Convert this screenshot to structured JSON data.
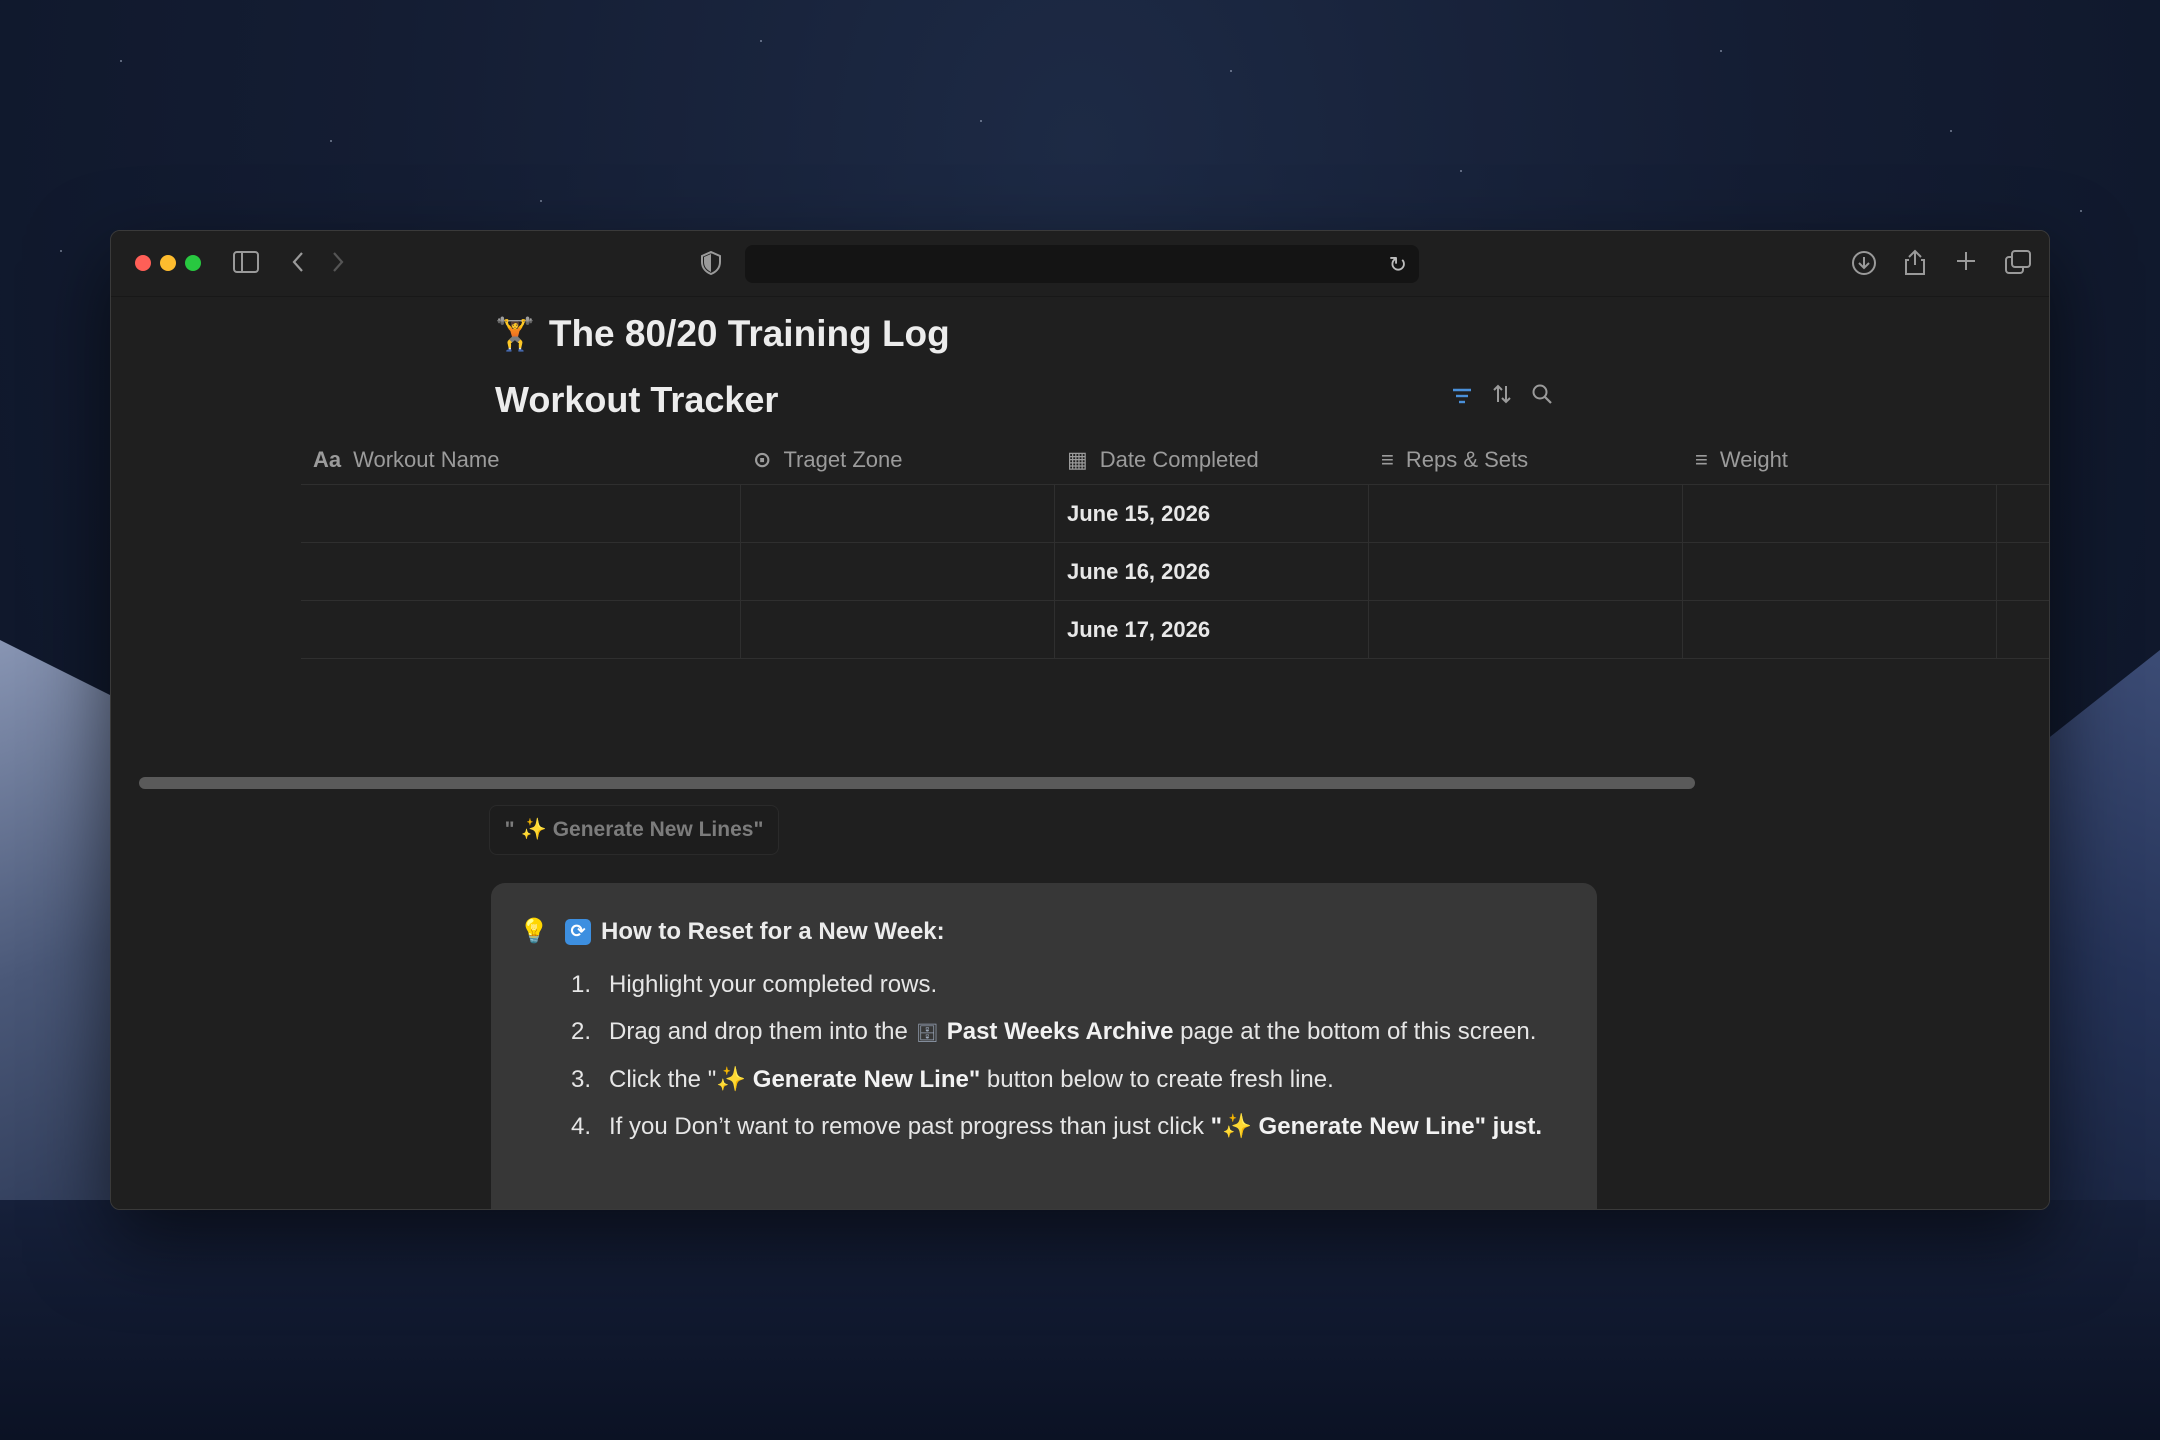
{
  "browser": {
    "url": "",
    "icons": {
      "sidebar": "sidebar-icon",
      "back": "chevron-left-icon",
      "forward": "chevron-right-icon",
      "privacy": "shield-icon",
      "reload": "reload-icon",
      "download": "download-icon",
      "share": "share-icon",
      "new_tab": "plus-icon",
      "tabs": "tab-overview-icon"
    }
  },
  "page": {
    "emoji": "🏋",
    "title": "The 80/20 Training Log"
  },
  "database": {
    "title": "Workout Tracker",
    "tools": [
      "filter-icon",
      "sort-icon",
      "search-icon"
    ],
    "columns": [
      {
        "icon": "Aa",
        "label": "Workout Name"
      },
      {
        "icon": "⊙",
        "label": "Traget Zone"
      },
      {
        "icon": "▦",
        "label": "Date Completed"
      },
      {
        "icon": "≡",
        "label": "Reps & Sets"
      },
      {
        "icon": "≡",
        "label": "Weight"
      }
    ],
    "rows": [
      {
        "name": "",
        "zone": "",
        "date": "June 15, 2026",
        "reps": "",
        "weight": ""
      },
      {
        "name": "",
        "zone": "",
        "date": "June 16, 2026",
        "reps": "",
        "weight": ""
      },
      {
        "name": "",
        "zone": "",
        "date": "June 17, 2026",
        "reps": "",
        "weight": ""
      }
    ]
  },
  "generate_button": {
    "quote_open": "\"",
    "spark": "✨",
    "label": "Generate New Lines\""
  },
  "callout": {
    "bulb": "💡",
    "cycle": "🔄",
    "title": "How to Reset for a New Week:",
    "steps": [
      {
        "num": "1.",
        "text": "Highlight your completed rows."
      },
      {
        "num": "2.",
        "pre": "Drag and drop them into the",
        "cab": "🗄",
        "bold": "Past Weeks Archive",
        "post": " page at the bottom of this screen."
      },
      {
        "num": "3.",
        "pre": "Click the \"",
        "spark": "✨",
        "bold": " Generate New Line\"",
        "post": " button below to create fresh line."
      },
      {
        "num": "4.",
        "pre": "If you Don’t want to remove past progress than just click ",
        "quote": "\"",
        "spark": "✨",
        "bold": " Generate New Line\" just."
      }
    ]
  },
  "colors": {
    "accent_blue": "#4a90d9",
    "window_bg": "#1f1f1f",
    "callout_bg": "#373737"
  }
}
